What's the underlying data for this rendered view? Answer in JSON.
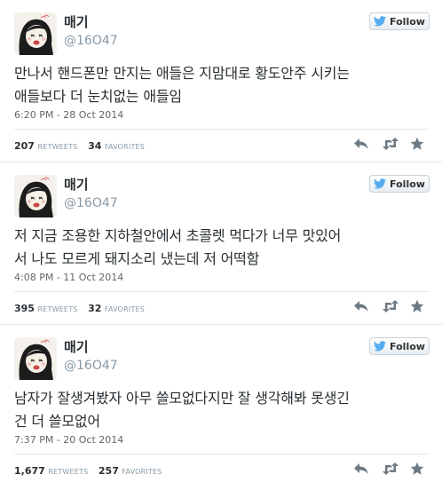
{
  "tweets": [
    {
      "name": "매기",
      "handle": "@16O47",
      "follow_label": "Follow",
      "text_lines": [
        "만나서 핸드폰만 만지는 애들은 지맘대로 황도안주 시키는",
        "애들보다 더 눈치없는 애들임"
      ],
      "timestamp": "6:20 PM - 28 Oct 2014",
      "retweets": "207",
      "retweets_label": "RETWEETS",
      "favorites": "34",
      "favorites_label": "FAVORITES"
    },
    {
      "name": "매기",
      "handle": "@16O47",
      "follow_label": "Follow",
      "text_lines": [
        "저 지금 조용한 지하철안에서 초콜렛 먹다가 너무 맛있어",
        "서 나도 모르게 돼지소리 냈는데 저 어떡함"
      ],
      "timestamp": "4:08 PM - 11 Oct 2014",
      "retweets": "395",
      "retweets_label": "RETWEETS",
      "favorites": "32",
      "favorites_label": "FAVORITES"
    },
    {
      "name": "매기",
      "handle": "@16O47",
      "follow_label": "Follow",
      "text_lines": [
        "남자가 잘생겨봤자 아무 쓸모없다지만 잘 생각해봐 못생긴",
        "건 더 쓸모없어"
      ],
      "timestamp": "7:37 PM - 20 Oct 2014",
      "retweets": "1,677",
      "retweets_label": "RETWEETS",
      "favorites": "257",
      "favorites_label": "FAVORITES"
    }
  ],
  "icons": {
    "bird": "twitter-bird-icon",
    "reply": "reply-icon",
    "retweet": "retweet-icon",
    "favorite": "star-icon"
  },
  "colors": {
    "bird": "#55acee",
    "action_icon": "#8899a6",
    "name": "#292f33",
    "handle": "#8899a6"
  }
}
